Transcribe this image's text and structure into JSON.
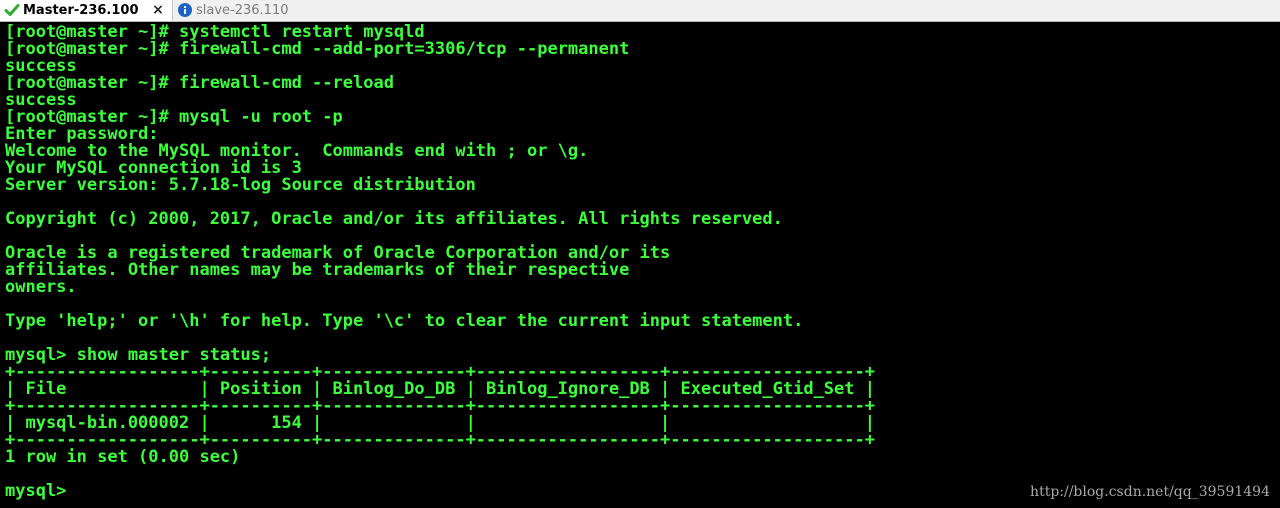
{
  "tabs": [
    {
      "label": "Master-236.100",
      "active": true,
      "icon": "check-icon",
      "icon_color": "#2eaa2e",
      "close": "×"
    },
    {
      "label": "slave-236.110",
      "active": false,
      "icon": "info-icon",
      "icon_color": "#1c63c7"
    }
  ],
  "terminal": {
    "text_color": "#3bff3b",
    "background": "#000000",
    "lines": [
      "[root@master ~]# systemctl restart mysqld",
      "[root@master ~]# firewall-cmd --add-port=3306/tcp --permanent",
      "success",
      "[root@master ~]# firewall-cmd --reload",
      "success",
      "[root@master ~]# mysql -u root -p",
      "Enter password:",
      "Welcome to the MySQL monitor.  Commands end with ; or \\g.",
      "Your MySQL connection id is 3",
      "Server version: 5.7.18-log Source distribution",
      "",
      "Copyright (c) 2000, 2017, Oracle and/or its affiliates. All rights reserved.",
      "",
      "Oracle is a registered trademark of Oracle Corporation and/or its",
      "affiliates. Other names may be trademarks of their respective",
      "owners.",
      "",
      "Type 'help;' or '\\h' for help. Type '\\c' to clear the current input statement.",
      "",
      "mysql> show master status;",
      "+------------------+----------+--------------+------------------+-------------------+",
      "| File             | Position | Binlog_Do_DB | Binlog_Ignore_DB | Executed_Gtid_Set |",
      "+------------------+----------+--------------+------------------+-------------------+",
      "| mysql-bin.000002 |      154 |              |                  |                   |",
      "+------------------+----------+--------------+------------------+-------------------+",
      "1 row in set (0.00 sec)",
      ""
    ],
    "prompt": "mysql> "
  },
  "watermark": "http://blog.csdn.net/qq_39591494"
}
